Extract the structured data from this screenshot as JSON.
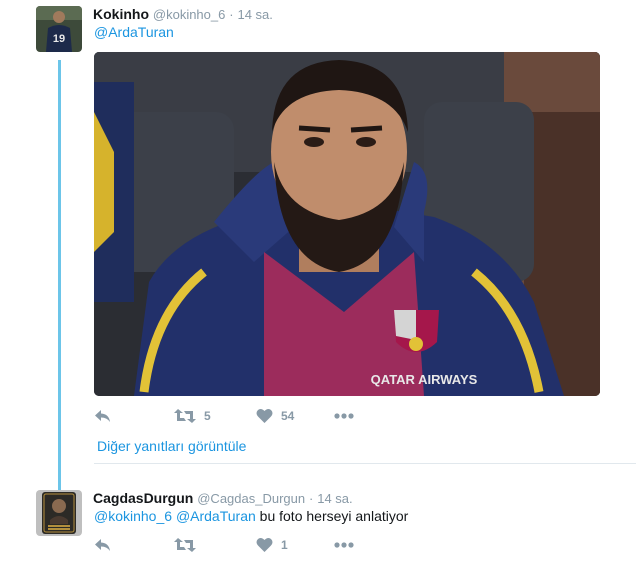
{
  "tweet1": {
    "fullname": "Kokinho",
    "handle": "@kokinho_6",
    "separator": "·",
    "time": "14 sa.",
    "text_mention": "@ArdaTuran",
    "avatar_icon": "player-avatar",
    "jersey_number": "19",
    "media_icon": "bench-photo",
    "media_lettering": "QATAR AIRWAYS",
    "actions": {
      "reply_icon": "reply-icon",
      "retweet_icon": "retweet-icon",
      "retweet_count": "5",
      "like_icon": "heart-icon",
      "like_count": "54",
      "more_icon": "more-icon"
    }
  },
  "show_more_replies": "Diğer yanıtları görüntüle",
  "tweet2": {
    "fullname": "CagdasDurgun",
    "handle": "@Cagdas_Durgun",
    "separator": "·",
    "time": "14 sa.",
    "mention1": "@kokinho_6",
    "mention2": "@ArdaTuran",
    "text": "bu foto herseyi anlatiyor",
    "avatar_icon": "player-card-avatar",
    "actions": {
      "reply_icon": "reply-icon",
      "retweet_icon": "retweet-icon",
      "like_icon": "heart-icon",
      "like_count": "1",
      "more_icon": "more-icon"
    }
  },
  "colors": {
    "link": "#1b95e0",
    "thread_line": "#6cc5e9",
    "meta": "#8899a6",
    "text": "#14171a"
  }
}
